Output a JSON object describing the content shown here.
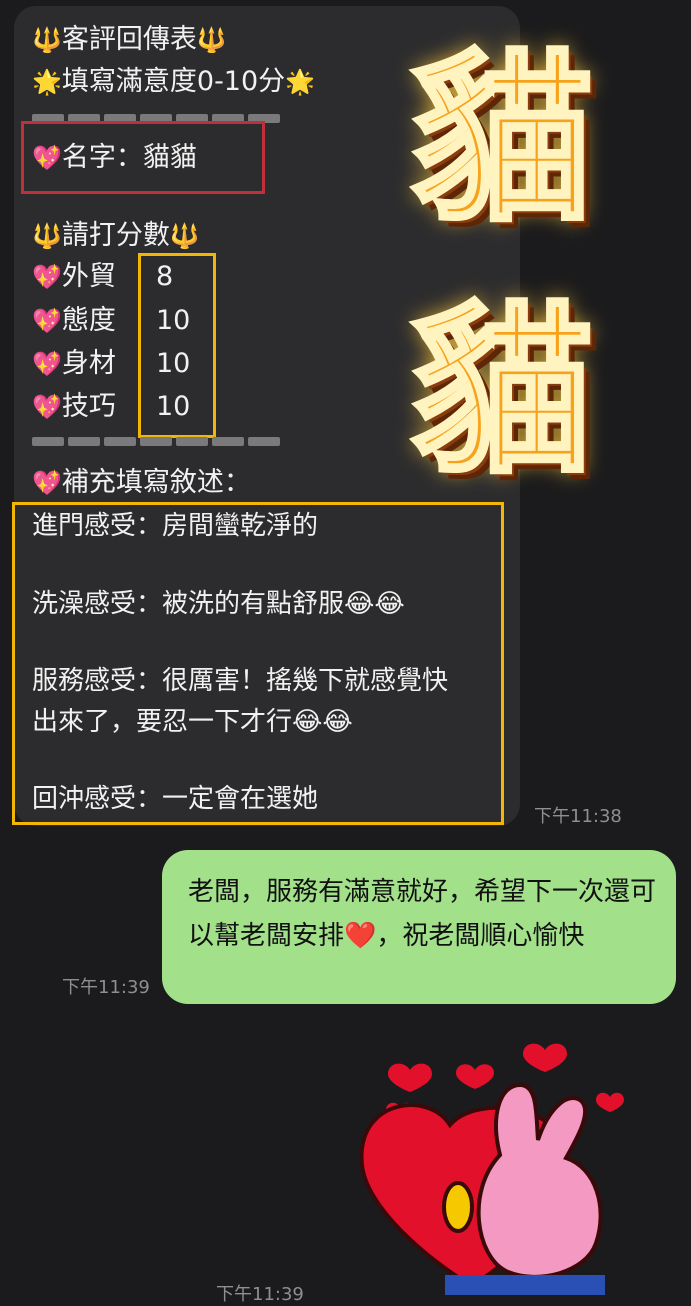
{
  "incoming": {
    "title_prefix": "🔱",
    "title": "客評回傳表",
    "title_suffix": "🔱",
    "subtitle_prefix": "🌟",
    "subtitle": "填寫滿意度0-10分",
    "subtitle_suffix": "🌟",
    "heart": "💖",
    "name_label": "名字：貓貓",
    "score_prompt": "請打分數",
    "score_items": [
      {
        "label": "外貿",
        "value": "8"
      },
      {
        "label": "態度",
        "value": "10"
      },
      {
        "label": "身材",
        "value": "10"
      },
      {
        "label": "技巧",
        "value": "10"
      }
    ],
    "supplement_label": "補充填寫敘述：",
    "reviews": [
      "進門感受：房間蠻乾淨的",
      "洗澡感受：被洗的有點舒服😂😂",
      "服務感受：很厲害！搖幾下就感覺快",
      "出來了，要忍一下才行😂😂",
      "回沖感受：一定會在選她"
    ],
    "time": "下午11:38"
  },
  "overlay_text": "貓貓",
  "outgoing": {
    "text": "老闆，服務有滿意就好，希望下一次還可以幫老闆安排❤️，祝老闆順心愉快",
    "time": "下午11:39"
  },
  "sticker_time": "下午11:39",
  "colors": {
    "incoming_bubble": "#2c2c2e",
    "outgoing_bubble": "#a2e08a",
    "red_frame": "#c0303a",
    "yellow_frame": "#f2b705",
    "overlay_text": "#f7a21b"
  }
}
